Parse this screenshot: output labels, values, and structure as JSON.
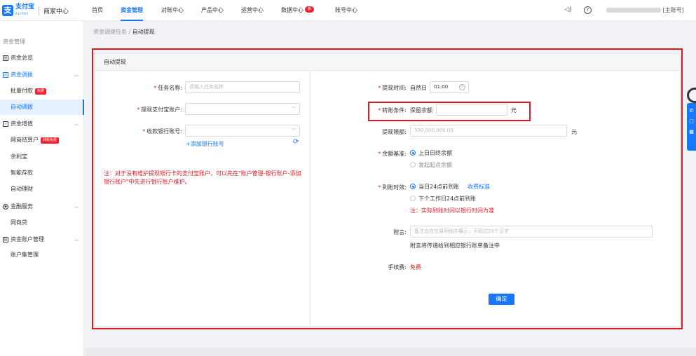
{
  "header": {
    "logo_cn": "支付宝",
    "logo_en": "ALIPAY",
    "portal": "商家中心",
    "nav": [
      "首页",
      "资金管理",
      "对账中心",
      "产品中心",
      "运营中心",
      "数据中心",
      "账号中心"
    ],
    "nav_badge": "新",
    "account_suffix": "[主账号]",
    "icons": {
      "speaker": "speaker-icon",
      "help": "help-icon"
    }
  },
  "sidebar": {
    "section_title": "资金管理",
    "g1": "资金总览",
    "g2": "资金调拨",
    "g2_item1": "批量付款",
    "g2_item1_tag": "免费",
    "g2_item2": "自动调拨",
    "g3": "资金增值",
    "g3_item1": "网商结算户",
    "g3_item1_tag": "转账免费",
    "g3_item2": "余利宝",
    "g3_item3": "智能存款",
    "g3_item4": "自动理财",
    "g4": "金融服务",
    "g4_item1": "网商贷",
    "g5": "资金账户管理",
    "g5_item1": "账户集管理"
  },
  "breadcrumb": {
    "parent": "资金调拨任务",
    "sep": "/",
    "current": "自动提现"
  },
  "panel": {
    "title": "自动提现",
    "left": {
      "task_name_label": "任务名称:",
      "task_name_placeholder": "请输入任务名称",
      "alipay_account_label": "提现支付宝账户:",
      "bank_account_label": "收款银行账号:",
      "add_bank_link": "+添加银行账号",
      "note": "注：对于没有维护提现银行卡的支付宝账户，可以先在\"账户管理-银行账户-添加银行账户\"中先进行银行账户维护。"
    },
    "right": {
      "time_label": "提现时间:",
      "time_prefix": "自然日",
      "time_value": "01:00",
      "condition_label": "转账条件:",
      "condition_prefix": "保留余额",
      "yuan": "元",
      "limit_label": "提现限额:",
      "limit_placeholder": "500,000,000.00",
      "basis_label": "余额基准:",
      "basis_opt1": "上日日终余额",
      "basis_opt2": "发起起点余额",
      "arrival_label": "到账时效:",
      "arrival_opt1": "当日24点前到账",
      "fee_std_link": "收费标准",
      "arrival_opt2": "下个工作日24点前到账",
      "arrival_note": "注：实际到账时间以银行时间为准",
      "remark_label": "附言:",
      "remark_placeholder": "备注会在交易明细中展示，不超过20个汉字",
      "remark_hint": "附言将传递给到相应银行账单备注中",
      "fee_label": "手续费:",
      "fee_value": "免费",
      "confirm": "确定"
    }
  },
  "colors": {
    "accent": "#1677ff",
    "highlight": "#e0171f"
  }
}
